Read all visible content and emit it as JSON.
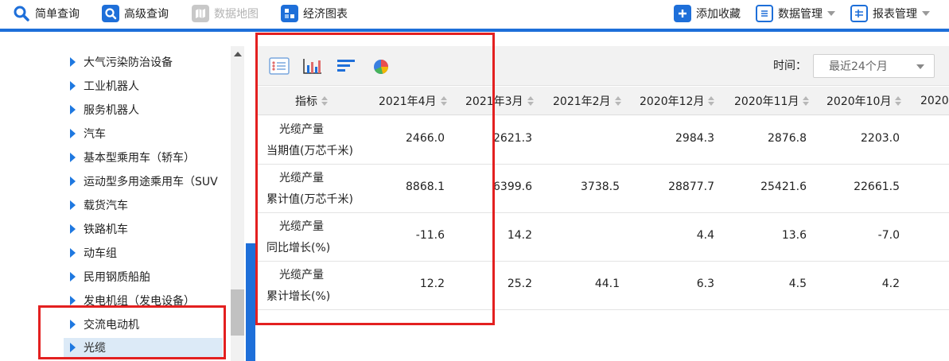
{
  "toolbar": {
    "simple_query": "简单查询",
    "advanced_query": "高级查询",
    "data_map": "数据地图",
    "economic_chart": "经济图表",
    "add_favorite": "添加收藏",
    "data_management": "数据管理",
    "report_management": "报表管理"
  },
  "tree": {
    "items": [
      {
        "label": "大气污染防治设备"
      },
      {
        "label": "工业机器人"
      },
      {
        "label": "服务机器人"
      },
      {
        "label": "汽车"
      },
      {
        "label": "基本型乘用车（轿车）"
      },
      {
        "label": "运动型多用途乘用车（SUV"
      },
      {
        "label": "载货汽车"
      },
      {
        "label": "铁路机车"
      },
      {
        "label": "动车组"
      },
      {
        "label": "民用钢质船舶"
      },
      {
        "label": "发电机组（发电设备）"
      },
      {
        "label": "交流电动机"
      },
      {
        "label": "光缆",
        "selected": true
      }
    ]
  },
  "panel": {
    "time_label": "时间：",
    "time_value": "最近24个月"
  },
  "table": {
    "indicator_header": "指标",
    "columns": [
      "2021年4月",
      "2021年3月",
      "2021年2月",
      "2020年12月",
      "2020年11月",
      "2020年10月",
      "2020"
    ],
    "rows": [
      {
        "name": "光缆产量",
        "sub": "当期值(万芯千米)",
        "values": [
          "2466.0",
          "2621.3",
          "",
          "2984.3",
          "2876.8",
          "2203.0"
        ]
      },
      {
        "name": "光缆产量",
        "sub": "累计值(万芯千米)",
        "values": [
          "8868.1",
          "6399.6",
          "3738.5",
          "28877.7",
          "25421.6",
          "22661.5"
        ]
      },
      {
        "name": "光缆产量",
        "sub": "同比增长(%)",
        "values": [
          "-11.6",
          "14.2",
          "",
          "4.4",
          "13.6",
          "-7.0"
        ]
      },
      {
        "name": "光缆产量",
        "sub": "累计增长(%)",
        "values": [
          "12.2",
          "25.2",
          "44.1",
          "6.3",
          "4.5",
          "4.2"
        ]
      }
    ]
  },
  "colors": {
    "accent": "#1e6fd9",
    "highlight_box": "#e32020",
    "tree_arrow": "#1e78e0"
  }
}
